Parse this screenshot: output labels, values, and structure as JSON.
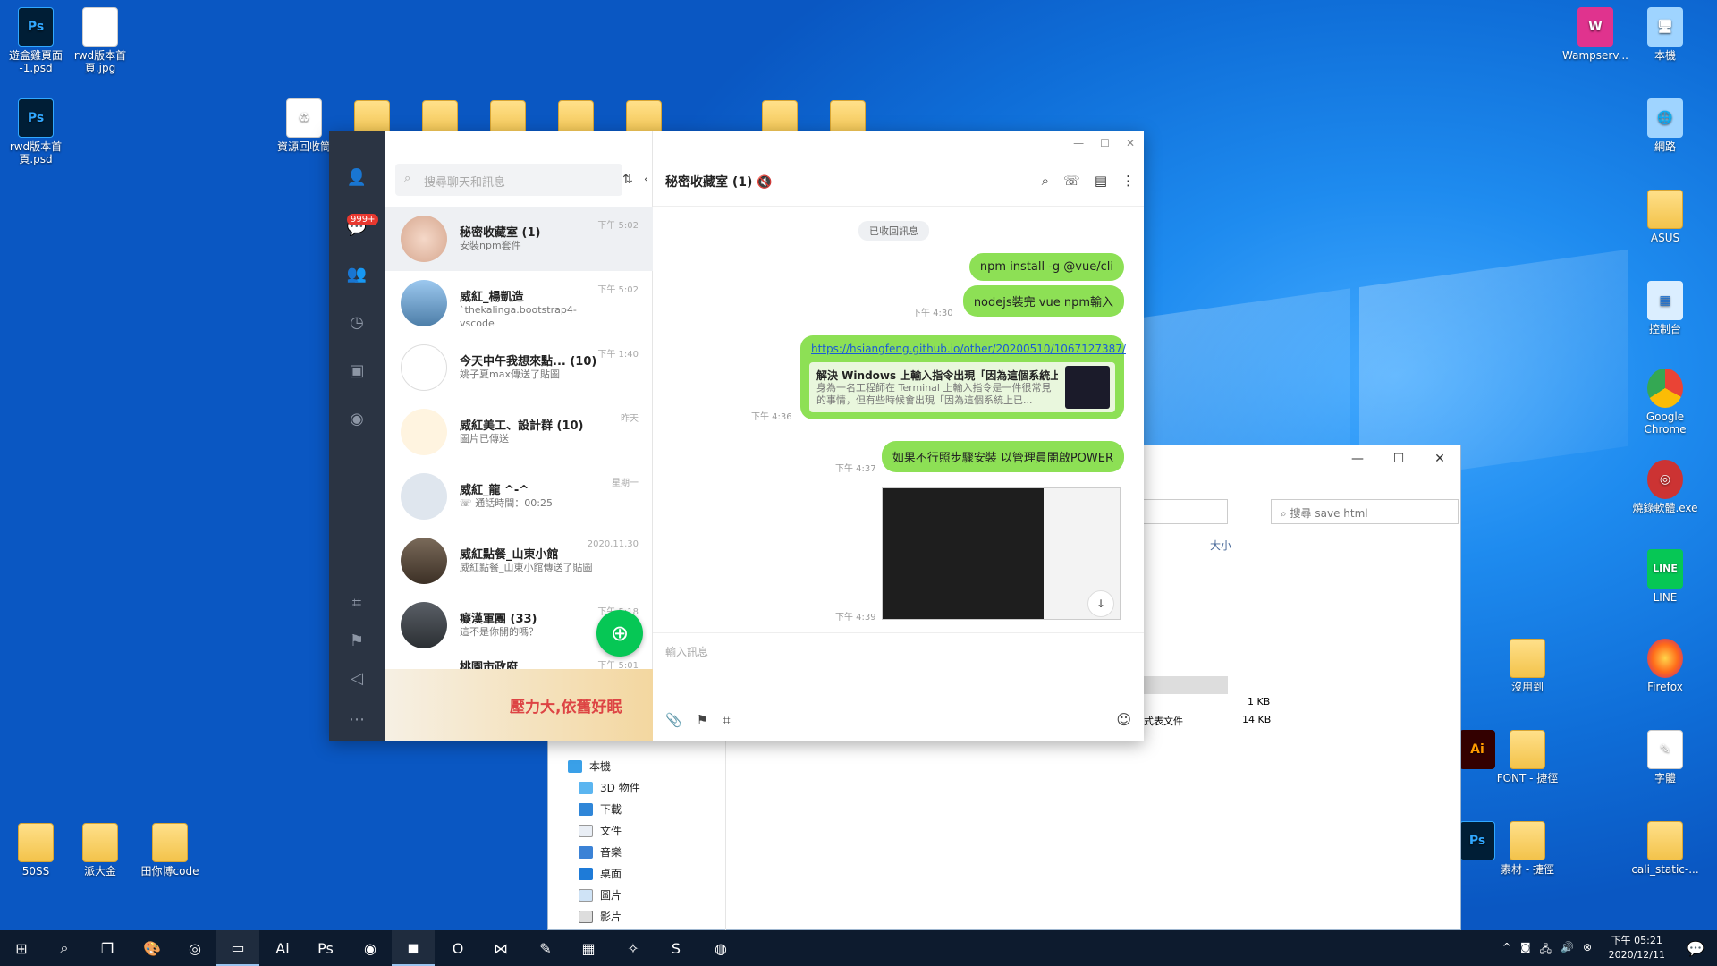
{
  "desktop": {
    "icons_left": [
      {
        "label": "遊盒雞頁面 -1.psd",
        "icon": "photoshop-icon"
      },
      {
        "label": "rwd版本首頁.jpg",
        "icon": "image-icon"
      },
      {
        "label": "rwd版本首頁.psd",
        "icon": "photoshop-icon"
      },
      {
        "label": "資源回收筒",
        "icon": "recycle-bin-icon"
      },
      {
        "label": "50SS",
        "icon": "folder-icon"
      },
      {
        "label": "派大金",
        "icon": "folder-icon"
      },
      {
        "label": "田你博code",
        "icon": "folder-icon"
      }
    ],
    "icons_right": [
      {
        "label": "Wampserv...",
        "icon": "wamp-icon"
      },
      {
        "label": "本機",
        "icon": "computer-icon"
      },
      {
        "label": "網路",
        "icon": "network-icon"
      },
      {
        "label": "ASUS",
        "icon": "folder-icon"
      },
      {
        "label": "控制台",
        "icon": "control-panel-icon"
      },
      {
        "label": "Google Chrome",
        "icon": "chrome-icon"
      },
      {
        "label": "燒錄軟體.exe",
        "icon": "burner-icon"
      },
      {
        "label": "LINE",
        "icon": "line-icon"
      },
      {
        "label": "Firefox",
        "icon": "firefox-icon"
      },
      {
        "label": "沒用到",
        "icon": "folder-icon"
      },
      {
        "label": "FONT - 捷徑",
        "icon": "folder-icon"
      },
      {
        "label": "字體",
        "icon": "folder-icon"
      },
      {
        "label": "素材 - 捷徑",
        "icon": "folder-icon"
      },
      {
        "label": "cali_static-...",
        "icon": "folder-icon"
      }
    ]
  },
  "explorer": {
    "search_placeholder": "搜尋 save html",
    "column_size": "大小",
    "file_sizes": [
      "1 KB",
      "14 KB"
    ],
    "file_type_partial": "式表文件",
    "nav": [
      "本機",
      "3D 物件",
      "下載",
      "文件",
      "音樂",
      "桌面",
      "圖片",
      "影片"
    ]
  },
  "line": {
    "badge": "999+",
    "search_placeholder": "搜尋聊天和訊息",
    "chats": [
      {
        "name": "秘密收藏室 (1)",
        "preview": "安裝npm套件",
        "time": "下午 5:02"
      },
      {
        "name": "威紅_楊凱造",
        "preview": "`thekalinga.bootstrap4-vscode",
        "time": "下午 5:02"
      },
      {
        "name": "今天中午我想來點... (10)",
        "preview": "姚子夏max傳送了貼圖",
        "time": "下午 1:40"
      },
      {
        "name": "威紅美工、設計群 (10)",
        "preview": "圖片已傳送",
        "time": "昨天"
      },
      {
        "name": "威紅_龍 ^-^",
        "preview": "通話時間：00:25",
        "time": "星期一"
      },
      {
        "name": "威紅點餐_山東小館",
        "preview": "威紅點餐_山東小館傳送了貼圖",
        "time": "2020.11.30"
      },
      {
        "name": "癡漢軍團 (33)",
        "preview": "這不是你開的嗎？",
        "time": "下午 5:18"
      },
      {
        "name": "桃園市政府",
        "preview": "",
        "time": "下午 5:01"
      }
    ],
    "ad_text": "壓力大,依舊好眠",
    "conversation": {
      "title": "秘密收藏室 (1)",
      "notice": "已收回訊息",
      "messages": [
        {
          "text": "npm install -g @vue/cli",
          "time": ""
        },
        {
          "text": "nodejs裝完 vue npm輸入",
          "time": "下午 4:30"
        },
        {
          "text": "如果不行照步驟安裝 以管理員開啟POWER",
          "time": "下午 4:37"
        }
      ],
      "link": {
        "url": "https://hsiangfeng.github.io/other/20200510/1067127387/",
        "title": "解決 Windows 上輸入指令出現「因為這個系統上...",
        "desc": "身為一名工程師在 Terminal 上輸入指令是一件很常見的事情，但有些時候會出現「因為這個系統上已...",
        "time": "下午 4:36"
      },
      "image_time": "下午 4:39",
      "input_placeholder": "輸入訊息"
    }
  },
  "taskbar": {
    "time": "下午 05:21",
    "date": "2020/12/11"
  }
}
